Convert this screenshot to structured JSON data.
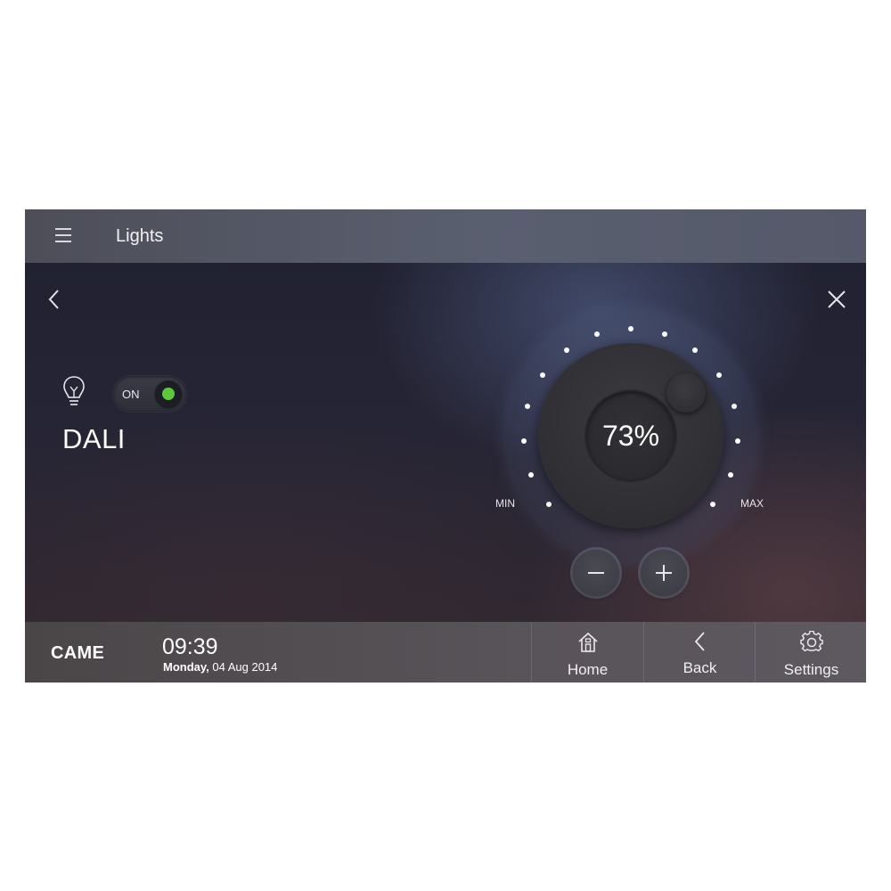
{
  "header": {
    "title": "Lights",
    "menu_icon": "hamburger-menu-icon"
  },
  "navigation": {
    "back_icon": "chevron-left-icon",
    "close_icon": "close-icon"
  },
  "device": {
    "icon": "light-bulb-icon",
    "name": "DALI",
    "toggle": {
      "label": "ON",
      "state": true,
      "indicator_color": "#5cc93c"
    }
  },
  "dimmer": {
    "value": 73,
    "value_text": "73%",
    "min_label": "MIN",
    "max_label": "MAX",
    "minus_icon": "minus-icon",
    "plus_icon": "plus-icon"
  },
  "footer": {
    "brand": "CAME",
    "time": "09:39",
    "date_weekday": "Monday,",
    "date_rest": " 04 Aug 2014",
    "nav": [
      {
        "label": "Home",
        "icon": "home-icon"
      },
      {
        "label": "Back",
        "icon": "chevron-left-icon"
      },
      {
        "label": "Settings",
        "icon": "gear-icon"
      }
    ]
  },
  "colors": {
    "accent_on": "#5cc93c",
    "text": "#ffffff"
  }
}
